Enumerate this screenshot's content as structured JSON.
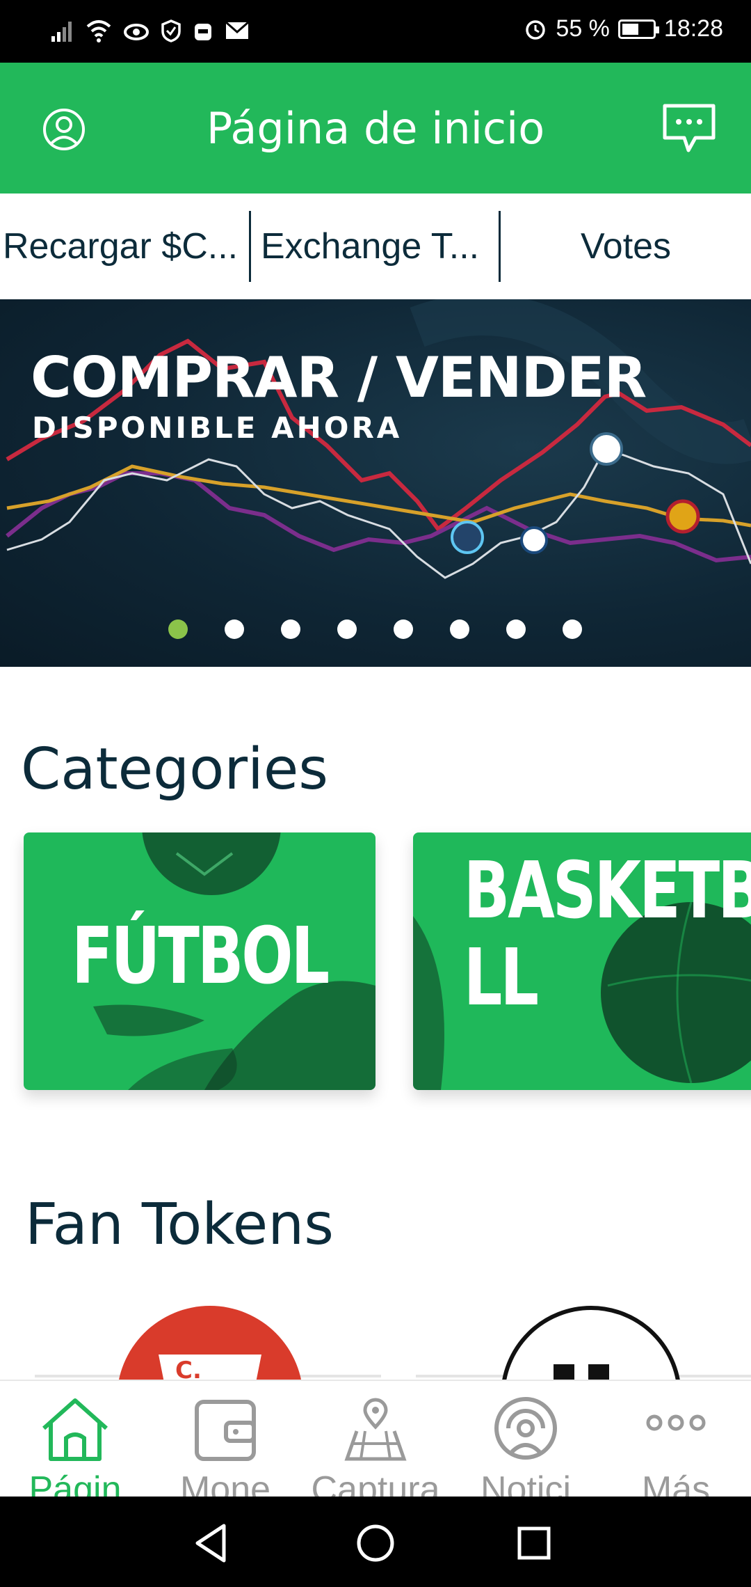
{
  "status_bar": {
    "battery": "55 %",
    "time": "18:28",
    "battery_level": 0.55,
    "icons": [
      "signal-icon",
      "wifi-icon",
      "eye-icon",
      "shield-icon",
      "robot-icon",
      "mail-icon",
      "alarm-icon",
      "battery-icon"
    ]
  },
  "header": {
    "title": "Página de inicio",
    "left_icon": "profile-icon",
    "right_icon": "chat-icon"
  },
  "quick_tabs": [
    {
      "label": "Recargar $C..."
    },
    {
      "label": "Exchange T..."
    },
    {
      "label": "Votes"
    }
  ],
  "banner": {
    "title": "COMPRAR / VENDER",
    "subtitle": "DISPONIBLE AHORA",
    "page_count": 8,
    "active_index": 0
  },
  "categories": {
    "title": "Categories",
    "items": [
      {
        "label": "FÚTBOL"
      },
      {
        "label": "BASKETBA\nLL"
      }
    ]
  },
  "fan_tokens": {
    "title": "Fan Tokens"
  },
  "bottom_nav": [
    {
      "label": "Págin",
      "icon": "home-icon",
      "active": true
    },
    {
      "label": "Mone",
      "icon": "wallet-icon",
      "active": false
    },
    {
      "label": "Captura",
      "icon": "map-icon",
      "active": false
    },
    {
      "label": "Notici",
      "icon": "broadcast-icon",
      "active": false
    },
    {
      "label": "Más",
      "icon": "more-icon",
      "active": false
    }
  ],
  "colors": {
    "brand_green": "#22b85a",
    "dark_text": "#0c2b3a",
    "inactive_gray": "#9a9a9a",
    "active_dot": "#8bc34a"
  }
}
